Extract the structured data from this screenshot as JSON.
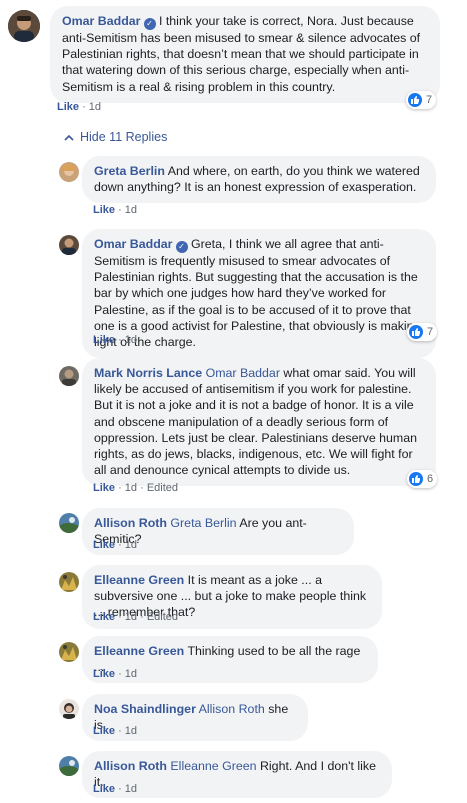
{
  "main_comment": {
    "author": "Omar Baddar",
    "text": "I think your take is correct, Nora. Just because anti-Semitism has been misused to smear & silence advocates of Palestinian rights, that doesn’t mean that we should participate in that watering down of this serious charge, especially when anti-Semitism is a real & rising problem in this country.",
    "like_label": "Like",
    "time": "1d",
    "reaction_count": "7"
  },
  "hide_replies_label": "Hide 11 Replies",
  "replies": [
    {
      "author": "Greta Berlin",
      "tag": "",
      "text": "And where, on earth, do you think we watered down anything? It is an honest expression of exasperation.",
      "like_label": "Like",
      "time": "1d",
      "edited": "",
      "reaction_count": ""
    },
    {
      "author": "Omar Baddar",
      "tag": "",
      "text": "Greta, I think we all agree that anti-Semitism is frequently misused to smear advocates of Palestinian rights. But suggesting that the accusation is the bar by which one judges how hard they’ve worked for Palestine, as if the goal is to be accused of it to prove that one is a good activist for Palestine, that obviously is making light of the charge.",
      "like_label": "Like",
      "time": "1d",
      "edited": "",
      "reaction_count": "7"
    },
    {
      "author": "Mark Norris Lance",
      "tag": "Omar Baddar",
      "text": "what omar said. You will likely be accused of antisemitism if you work for palestine. But it is not a joke and it is not a badge of honor. It is a vile and obscene manipulation of a deadly serious form of oppression. Lets just be clear. Palestinians deserve human rights, as do jews, blacks, indigenous, etc. We will fight for all and denounce cynical attempts to divide us.",
      "like_label": "Like",
      "time": "1d",
      "edited": "Edited",
      "reaction_count": "6"
    },
    {
      "author": "Allison Roth",
      "tag": "Greta Berlin",
      "text": "Are you ant-Semitic?",
      "like_label": "Like",
      "time": "1d",
      "edited": "",
      "reaction_count": ""
    },
    {
      "author": "Elleanne Green",
      "tag": "",
      "text": "It is meant as a joke ... a subversive one ... but a joke to make people think ... remember that?",
      "like_label": "Like",
      "time": "1d",
      "edited": "Edited",
      "reaction_count": ""
    },
    {
      "author": "Elleanne Green",
      "tag": "",
      "text": "Thinking used to be all the rage ...",
      "like_label": "Like",
      "time": "1d",
      "edited": "",
      "reaction_count": ""
    },
    {
      "author": "Noa Shaindlinger",
      "tag": "Allison Roth",
      "text": "she is.",
      "like_label": "Like",
      "time": "1d",
      "edited": "",
      "reaction_count": ""
    },
    {
      "author": "Allison Roth",
      "tag": "Elleanne Green",
      "text": "Right. And I don't like it.",
      "like_label": "Like",
      "time": "1d",
      "edited": "",
      "reaction_count": ""
    }
  ],
  "colors": {
    "link": "#385898",
    "bubble": "#f2f3f5",
    "like_reaction": "#1877f2",
    "meta": "#606770"
  },
  "icons": [
    "verified-badge-icon",
    "chevron-up-icon",
    "like-reaction-icon"
  ]
}
